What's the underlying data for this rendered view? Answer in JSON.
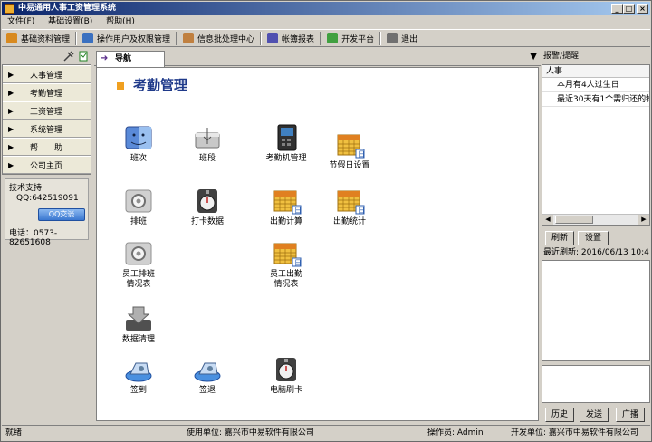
{
  "window": {
    "title": "中易通用人事工资管理系统"
  },
  "menu": [
    "文件(F)",
    "基础设置(B)",
    "帮助(H)"
  ],
  "toolbar": [
    {
      "label": "基础资料管理",
      "icon": "user-group-icon",
      "color": "#d88a20"
    },
    {
      "label": "操作用户及权限管理",
      "icon": "users-key-icon",
      "color": "#3a70c0"
    },
    {
      "label": "信息批处理中心",
      "icon": "document-icon",
      "color": "#c08040"
    },
    {
      "label": "帐簿报表",
      "icon": "chart-icon",
      "color": "#5050b0"
    },
    {
      "label": "开发平台",
      "icon": "pencil-icon",
      "color": "#40a040"
    },
    {
      "label": "退出",
      "icon": "exit-icon",
      "color": "#707070"
    }
  ],
  "sidebar": {
    "items": [
      {
        "label": "人事管理"
      },
      {
        "label": "考勤管理"
      },
      {
        "label": "工资管理"
      },
      {
        "label": "系统管理"
      },
      {
        "label": "帮　　助"
      },
      {
        "label": "公司主页"
      }
    ],
    "support": {
      "title": "技术支持",
      "qq": "QQ:642519091",
      "qq_button": "QQ交谈",
      "phone": "电话：0573-82651608"
    }
  },
  "main": {
    "tab_label": "导航",
    "title": "考勤管理",
    "tiles": [
      {
        "label": "班次",
        "icon": "finder-icon"
      },
      {
        "label": "班段",
        "icon": "usb-icon"
      },
      {
        "label": "考勤机管理",
        "icon": "fingerprint-device-icon"
      },
      {
        "label": "节假日设置",
        "icon": "calendar-icon"
      },
      {
        "label": "排班",
        "icon": "gear-icon"
      },
      {
        "label": "打卡数据",
        "icon": "stopwatch-icon"
      },
      {
        "label": "出勤计算",
        "icon": "calendar-icon"
      },
      {
        "label": "出勤统计",
        "icon": "calendar-icon"
      },
      {
        "label": "员工排班\n情况表",
        "icon": "gear-icon"
      },
      {
        "label": "员工出勤\n情况表",
        "icon": "calendar-icon"
      },
      {
        "label": "数据清理",
        "icon": "download-tray-icon"
      },
      {
        "label": "签到",
        "icon": "speaker-icon"
      },
      {
        "label": "签退",
        "icon": "speaker-icon"
      },
      {
        "label": "电脑刷卡",
        "icon": "stopwatch-icon"
      }
    ]
  },
  "right_panel": {
    "header": "报警/提醒:",
    "list_header": "人事",
    "rows": [
      "本月有4人过生日",
      "最近30天有1个需归还的物"
    ],
    "refresh_button": "刷新",
    "settings_button": "设置",
    "last_refresh": "最近刷新: 2016/06/13  10:4",
    "history_button": "历史",
    "send_button": "发送",
    "broadcast_button": "广播"
  },
  "status": {
    "ready": "就绪",
    "user_unit": "使用单位: 嘉兴市中易软件有限公司",
    "operator": "操作员: Admin",
    "developer": "开发单位: 嘉兴市中易软件有限公司"
  }
}
